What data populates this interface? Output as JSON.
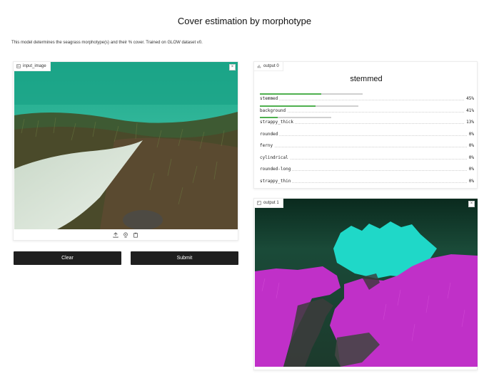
{
  "page": {
    "title": "Cover estimation by morphotype",
    "description": "This model determines the seagrass morphotype(s) and their % cover. Trained on GLOW dataset v0."
  },
  "input_panel": {
    "label": "input_image",
    "close_glyph": "×",
    "toolbar_icons": [
      "upload-icon",
      "webcam-icon",
      "clipboard-icon"
    ]
  },
  "buttons": {
    "clear": "Clear",
    "submit": "Submit"
  },
  "output0": {
    "label": "output 0",
    "top_label": "stemmed",
    "confidences": [
      {
        "name": "stemmed",
        "value": "45%",
        "fraction": 0.45
      },
      {
        "name": "background",
        "value": "41%",
        "fraction": 0.41
      },
      {
        "name": "strappy_thick",
        "value": "13%",
        "fraction": 0.13
      },
      {
        "name": "rounded",
        "value": "0%",
        "fraction": 0.0
      },
      {
        "name": "ferny",
        "value": "0%",
        "fraction": 0.0
      },
      {
        "name": "cylindrical",
        "value": "0%",
        "fraction": 0.0
      },
      {
        "name": "rounded-long",
        "value": "0%",
        "fraction": 0.0
      },
      {
        "name": "strappy_thin",
        "value": "0%",
        "fraction": 0.0
      }
    ],
    "bar_color": "#4fb04f"
  },
  "output1": {
    "label": "output 1",
    "close_glyph": "×",
    "mask_colors": {
      "stemmed": "#c030c8",
      "background": "#1fd8c8"
    }
  }
}
